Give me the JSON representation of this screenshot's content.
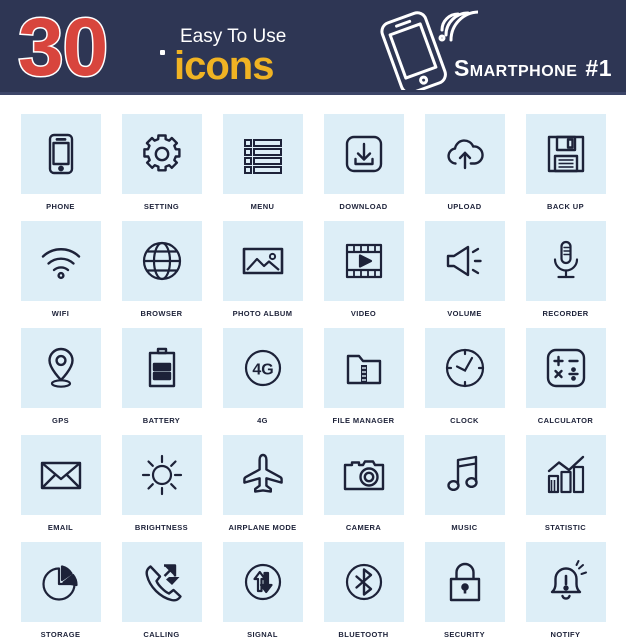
{
  "header": {
    "count": "30",
    "tagline_top": "Easy To Use",
    "tagline_bottom": "icons",
    "series_name": "Smartphone",
    "series_number": "#1",
    "mark_icon": "smartphone-wifi-icon",
    "colors": {
      "header_bg": "#2e3654",
      "number_fill": "#d8453d",
      "number_stroke": "#ffffff",
      "tagline_top_color": "#ffffff",
      "tagline_bottom_color": "#f0b323",
      "tile_bg": "#ddeef7",
      "icon_stroke": "#1d2239",
      "label_color": "#1d2239"
    }
  },
  "grid": {
    "columns": 6,
    "rows": 5,
    "items": [
      {
        "label": "PHONE",
        "icon": "phone-icon"
      },
      {
        "label": "SETTING",
        "icon": "gear-icon"
      },
      {
        "label": "MENU",
        "icon": "menu-list-icon"
      },
      {
        "label": "DOWNLOAD",
        "icon": "download-icon"
      },
      {
        "label": "UPLOAD",
        "icon": "cloud-upload-icon"
      },
      {
        "label": "BACK UP",
        "icon": "floppy-disk-icon"
      },
      {
        "label": "WIFI",
        "icon": "wifi-icon"
      },
      {
        "label": "BROWSER",
        "icon": "globe-icon"
      },
      {
        "label": "PHOTO ALBUM",
        "icon": "photo-icon"
      },
      {
        "label": "VIDEO",
        "icon": "film-play-icon"
      },
      {
        "label": "VOLUME",
        "icon": "speaker-icon"
      },
      {
        "label": "RECORDER",
        "icon": "microphone-icon"
      },
      {
        "label": "GPS",
        "icon": "map-pin-icon"
      },
      {
        "label": "BATTERY",
        "icon": "battery-icon"
      },
      {
        "label": "4G",
        "icon": "four-g-icon"
      },
      {
        "label": "FILE MANAGER",
        "icon": "folder-zip-icon"
      },
      {
        "label": "CLOCK",
        "icon": "clock-icon"
      },
      {
        "label": "CALCULATOR",
        "icon": "calculator-icon"
      },
      {
        "label": "EMAIL",
        "icon": "envelope-icon"
      },
      {
        "label": "BRIGHTNESS",
        "icon": "sun-icon"
      },
      {
        "label": "AIRPLANE MODE",
        "icon": "airplane-icon"
      },
      {
        "label": "CAMERA",
        "icon": "camera-icon"
      },
      {
        "label": "MUSIC",
        "icon": "music-note-icon"
      },
      {
        "label": "STATISTIC",
        "icon": "bar-chart-icon"
      },
      {
        "label": "STORAGE",
        "icon": "pie-chart-icon"
      },
      {
        "label": "CALLING",
        "icon": "handset-arrows-icon"
      },
      {
        "label": "SIGNAL",
        "icon": "up-down-arrows-icon"
      },
      {
        "label": "BLUETOOTH",
        "icon": "bluetooth-icon"
      },
      {
        "label": "SECURITY",
        "icon": "padlock-icon"
      },
      {
        "label": "NOTIFY",
        "icon": "bell-alert-icon"
      }
    ],
    "icon_glyph_4g": "4G"
  }
}
